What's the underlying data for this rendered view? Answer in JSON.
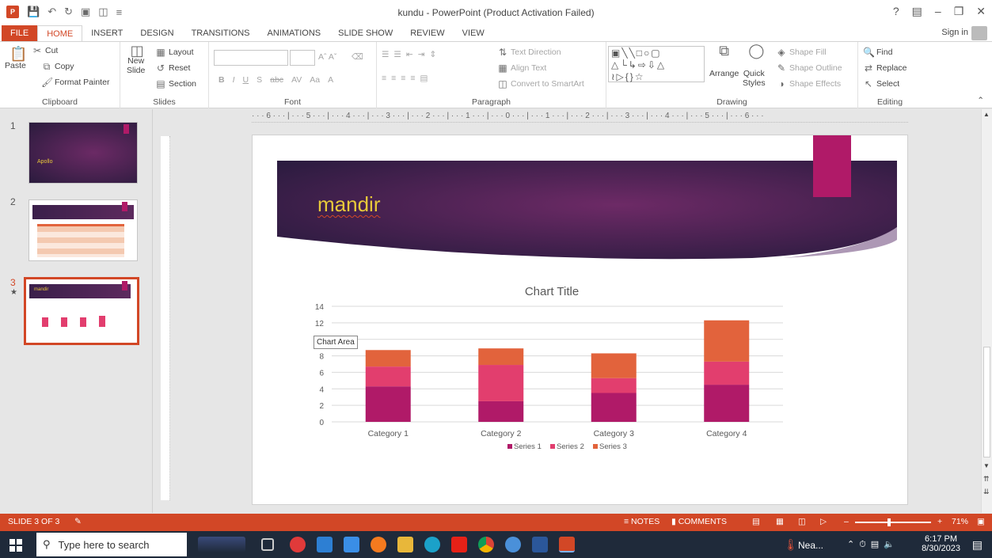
{
  "window": {
    "title": "kundu - PowerPoint (Product Activation Failed)",
    "help": "?",
    "sign_in": "Sign in"
  },
  "tabs": [
    "FILE",
    "HOME",
    "INSERT",
    "DESIGN",
    "TRANSITIONS",
    "ANIMATIONS",
    "SLIDE SHOW",
    "REVIEW",
    "VIEW"
  ],
  "ribbon": {
    "clipboard": {
      "paste": "Paste",
      "cut": "Cut",
      "copy": "Copy",
      "format_painter": "Format Painter",
      "label": "Clipboard"
    },
    "slides": {
      "new_slide": "New",
      "new_slide_2": "Slide",
      "layout": "Layout",
      "reset": "Reset",
      "section": "Section",
      "label": "Slides"
    },
    "font": {
      "label": "Font",
      "bold": "B",
      "italic": "I",
      "underline": "U",
      "shadow": "S",
      "strike": "abc",
      "spacing": "AV",
      "case": "Aa"
    },
    "paragraph": {
      "label": "Paragraph",
      "text_direction": "Text Direction",
      "align_text": "Align Text",
      "convert_smartart": "Convert to SmartArt"
    },
    "drawing": {
      "label": "Drawing",
      "arrange": "Arrange",
      "quick_styles": "Quick",
      "quick_styles_2": "Styles",
      "shape_fill": "Shape Fill",
      "shape_outline": "Shape Outline",
      "shape_effects": "Shape Effects"
    },
    "editing": {
      "label": "Editing",
      "find": "Find",
      "replace": "Replace",
      "select": "Select"
    }
  },
  "thumbnails": [
    {
      "num": "1",
      "text": "Apollo"
    },
    {
      "num": "2",
      "text": ""
    },
    {
      "num": "3",
      "text": "mandir"
    }
  ],
  "ruler_top": "· · · 6 · · · | · · · 5 · · · | · · · 4 · · · | · · · 3 · · · | · · · 2 · · · | · · · 1 · · · | · · · 0 · · · | · · · 1 · · · | · · · 2 · · · | · · · 3 · · · | · · · 4 · · · | · · · 5 · · · | · · · 6 · · ·",
  "slide": {
    "title": "mandir",
    "tooltip": "Chart Area"
  },
  "chart_data": {
    "type": "bar",
    "stacked": true,
    "title": "Chart Title",
    "categories": [
      "Category 1",
      "Category 2",
      "Category 3",
      "Category 4"
    ],
    "series": [
      {
        "name": "Series 1",
        "values": [
          4.3,
          2.5,
          3.5,
          4.5
        ],
        "color": "#b01a68"
      },
      {
        "name": "Series 2",
        "values": [
          2.4,
          4.4,
          1.8,
          2.8
        ],
        "color": "#e23e6e"
      },
      {
        "name": "Series 3",
        "values": [
          2.0,
          2.0,
          3.0,
          5.0
        ],
        "color": "#e2633c"
      }
    ],
    "ylim": [
      0,
      14
    ],
    "yticks": [
      0,
      2,
      4,
      6,
      8,
      10,
      12,
      14
    ],
    "grid": true,
    "legend": "bottom"
  },
  "status": {
    "slide_of": "SLIDE 3 OF 3",
    "notes": "NOTES",
    "comments": "COMMENTS",
    "zoom": "71%"
  },
  "taskbar": {
    "search_placeholder": "Type here to search",
    "weather": "Nea...",
    "time": "6:17 PM",
    "date": "8/30/2023"
  },
  "colors": {
    "accent": "#d24726",
    "title_yellow": "#e8c93a",
    "banner_dark": "#2c1d45"
  }
}
